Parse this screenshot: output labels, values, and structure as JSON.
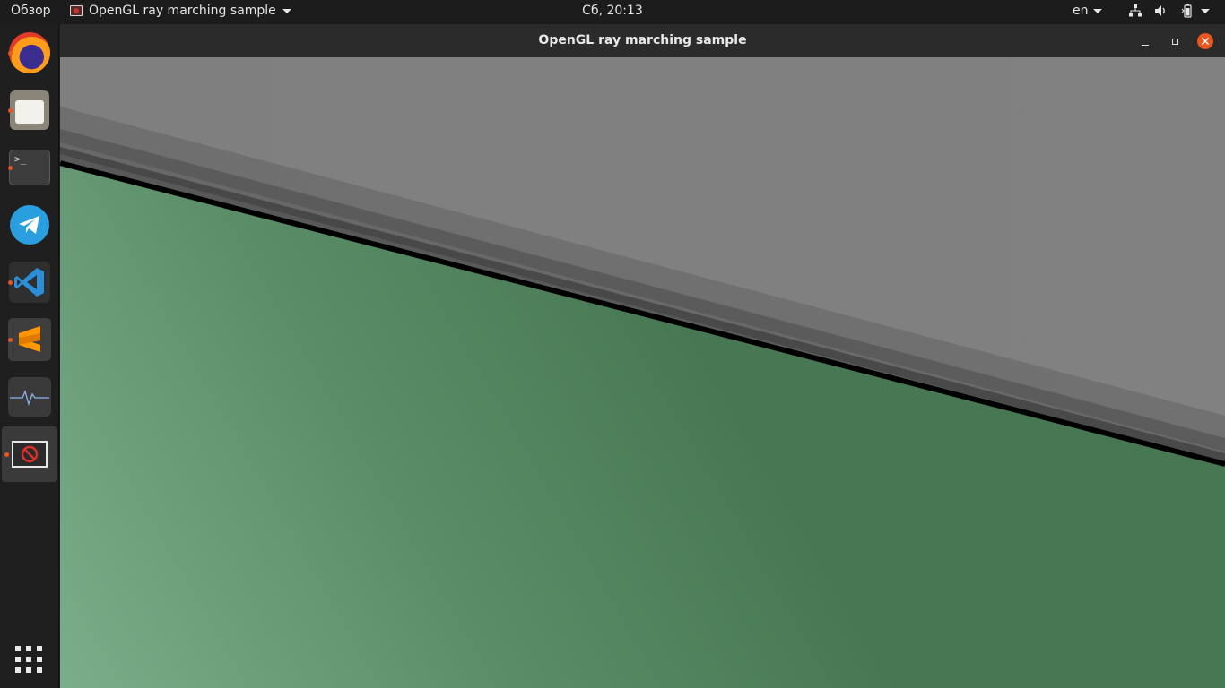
{
  "topbar": {
    "activities_label": "Обзор",
    "app_menu_label": "OpenGL ray marching sample",
    "clock": "Сб, 20:13",
    "language": "en"
  },
  "dock": {
    "items": [
      {
        "name": "Firefox",
        "running": true
      },
      {
        "name": "Files",
        "running": true
      },
      {
        "name": "Terminal",
        "running": true,
        "glyph": ">_"
      },
      {
        "name": "Telegram",
        "running": false
      },
      {
        "name": "Visual Studio Code",
        "running": true
      },
      {
        "name": "Sublime Text",
        "running": true
      },
      {
        "name": "System Monitor",
        "running": false
      },
      {
        "name": "OpenGL ray marching sample",
        "running": true,
        "active": true
      }
    ]
  },
  "window": {
    "title": "OpenGL ray marching sample"
  },
  "colors": {
    "accent": "#e9541f",
    "sky_gray": "#808080",
    "ground_green_light": "#7aae8a",
    "ground_green_dark": "#477853",
    "horizon_line": "#000000"
  }
}
